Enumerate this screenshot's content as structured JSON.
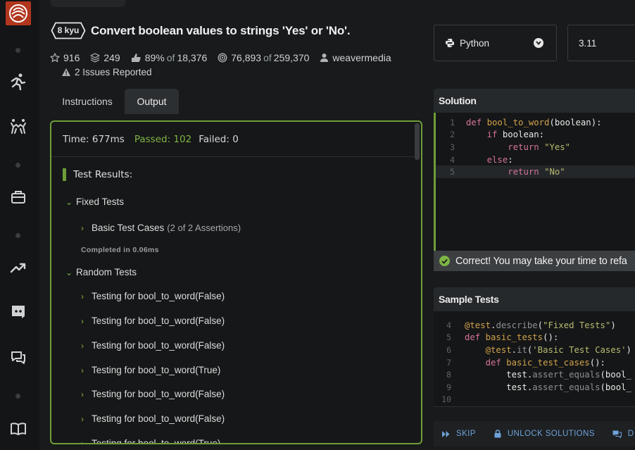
{
  "sidebar": {
    "logo": "codewars-logo",
    "items": [
      {
        "name": "practice",
        "icon": "practice-icon"
      },
      {
        "name": "compete",
        "icon": "compete-icon"
      },
      {
        "name": "training",
        "icon": "briefcase-icon"
      },
      {
        "name": "leaderboards",
        "icon": "trending-up-icon"
      },
      {
        "name": "discord",
        "icon": "discord-icon"
      },
      {
        "name": "discussions",
        "icon": "chat-icon"
      },
      {
        "name": "docs",
        "icon": "book-icon"
      }
    ]
  },
  "kata": {
    "rank": "8 kyu",
    "title": "Convert boolean values to strings 'Yes' or 'No'.",
    "stars": "916",
    "collections": "249",
    "satisfaction_pct": "89%",
    "satisfaction_of": "of",
    "satisfaction_total": "18,376",
    "completed": "76,893",
    "completed_of": "of",
    "attempts_total": "259,370",
    "author": "weavermedia",
    "issues": "2 Issues Reported"
  },
  "tabs": {
    "instructions": "Instructions",
    "output": "Output",
    "active": "Output"
  },
  "output": {
    "time": "Time: 677ms",
    "passed": "Passed: 102",
    "failed": "Failed: 0",
    "results_title": "Test Results:",
    "fixed_group": "Fixed Tests",
    "basic_case": "Basic Test Cases",
    "basic_assertions": "(2 of 2 Assertions)",
    "completed_in": "Completed in 0.06ms",
    "random_group": "Random Tests",
    "random_tests": [
      "Testing for bool_to_word(False)",
      "Testing for bool_to_word(False)",
      "Testing for bool_to_word(False)",
      "Testing for bool_to_word(True)",
      "Testing for bool_to_word(False)",
      "Testing for bool_to_word(False)",
      "Testing for bool_to_word(True)"
    ]
  },
  "language": {
    "selected": "Python",
    "version": "3.11"
  },
  "solution": {
    "title": "Solution",
    "correct_message": "Correct! You may take your time to refa"
  },
  "sample_tests": {
    "title": "Sample Tests"
  },
  "actions": {
    "skip": "SKIP",
    "unlock": "UNLOCK SOLUTIONS",
    "discuss": "D"
  },
  "colors": {
    "accent_green": "#6e9d38",
    "passed_green": "#7fb446",
    "logo_red": "#b1361e",
    "link_blue": "#6ea3da"
  }
}
